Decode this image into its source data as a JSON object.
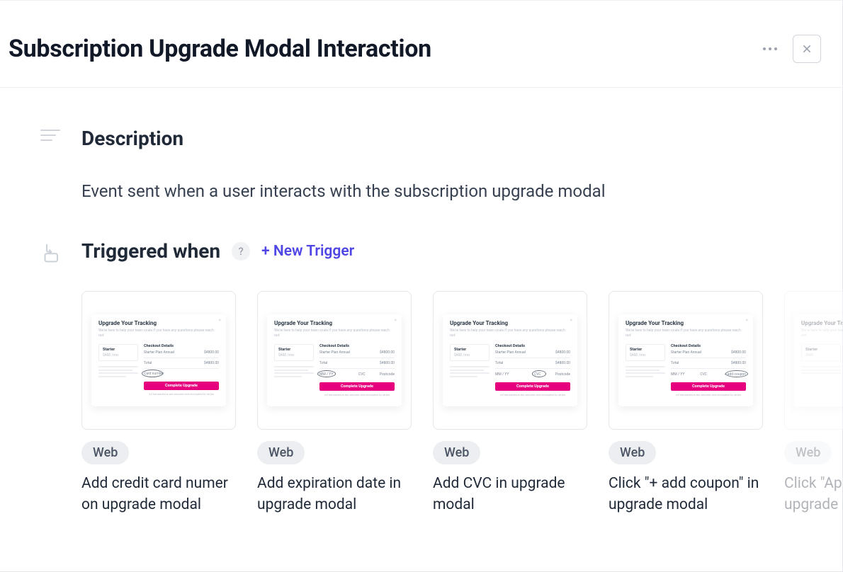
{
  "header": {
    "title": "Subscription Upgrade Modal Interaction"
  },
  "description": {
    "heading": "Description",
    "body": "Event sent when a user interacts with the subscription upgrade modal"
  },
  "triggers": {
    "heading": "Triggered when",
    "help": "?",
    "new_trigger_label": "+ New Trigger",
    "items": [
      {
        "platform": "Web",
        "title": "Add credit card numer on upgrade modal"
      },
      {
        "platform": "Web",
        "title": "Add expiration date in upgrade modal"
      },
      {
        "platform": "Web",
        "title": "Add CVC in upgrade modal"
      },
      {
        "platform": "Web",
        "title": "Click \"+ add coupon\" in upgrade modal"
      },
      {
        "platform": "Web",
        "title": "Click \"Apply coupon\" in upgrade modal"
      }
    ]
  },
  "mini": {
    "title": "Upgrade Your Tracking",
    "sub": "We're here to help your team scale if you have any questions please reach out.",
    "plan_label": "Starter",
    "plan_price": "$400",
    "plan_price_suffix": " /mo",
    "checkout_head": "Checkout Details",
    "row1_l": "Starter Plan Annual",
    "row1_r": "$4800.00",
    "row2_l": "Total",
    "row2_r": "$4800.00",
    "cc_num": "Card number",
    "cc_exp": "MM / YY",
    "cc_cvc": "CVC",
    "cc_zip": "Postcode",
    "cc_coupon": "+ add coupon",
    "button": "Complete Upgrade",
    "foot": "All transactions are secured and encrypted by stripe"
  }
}
